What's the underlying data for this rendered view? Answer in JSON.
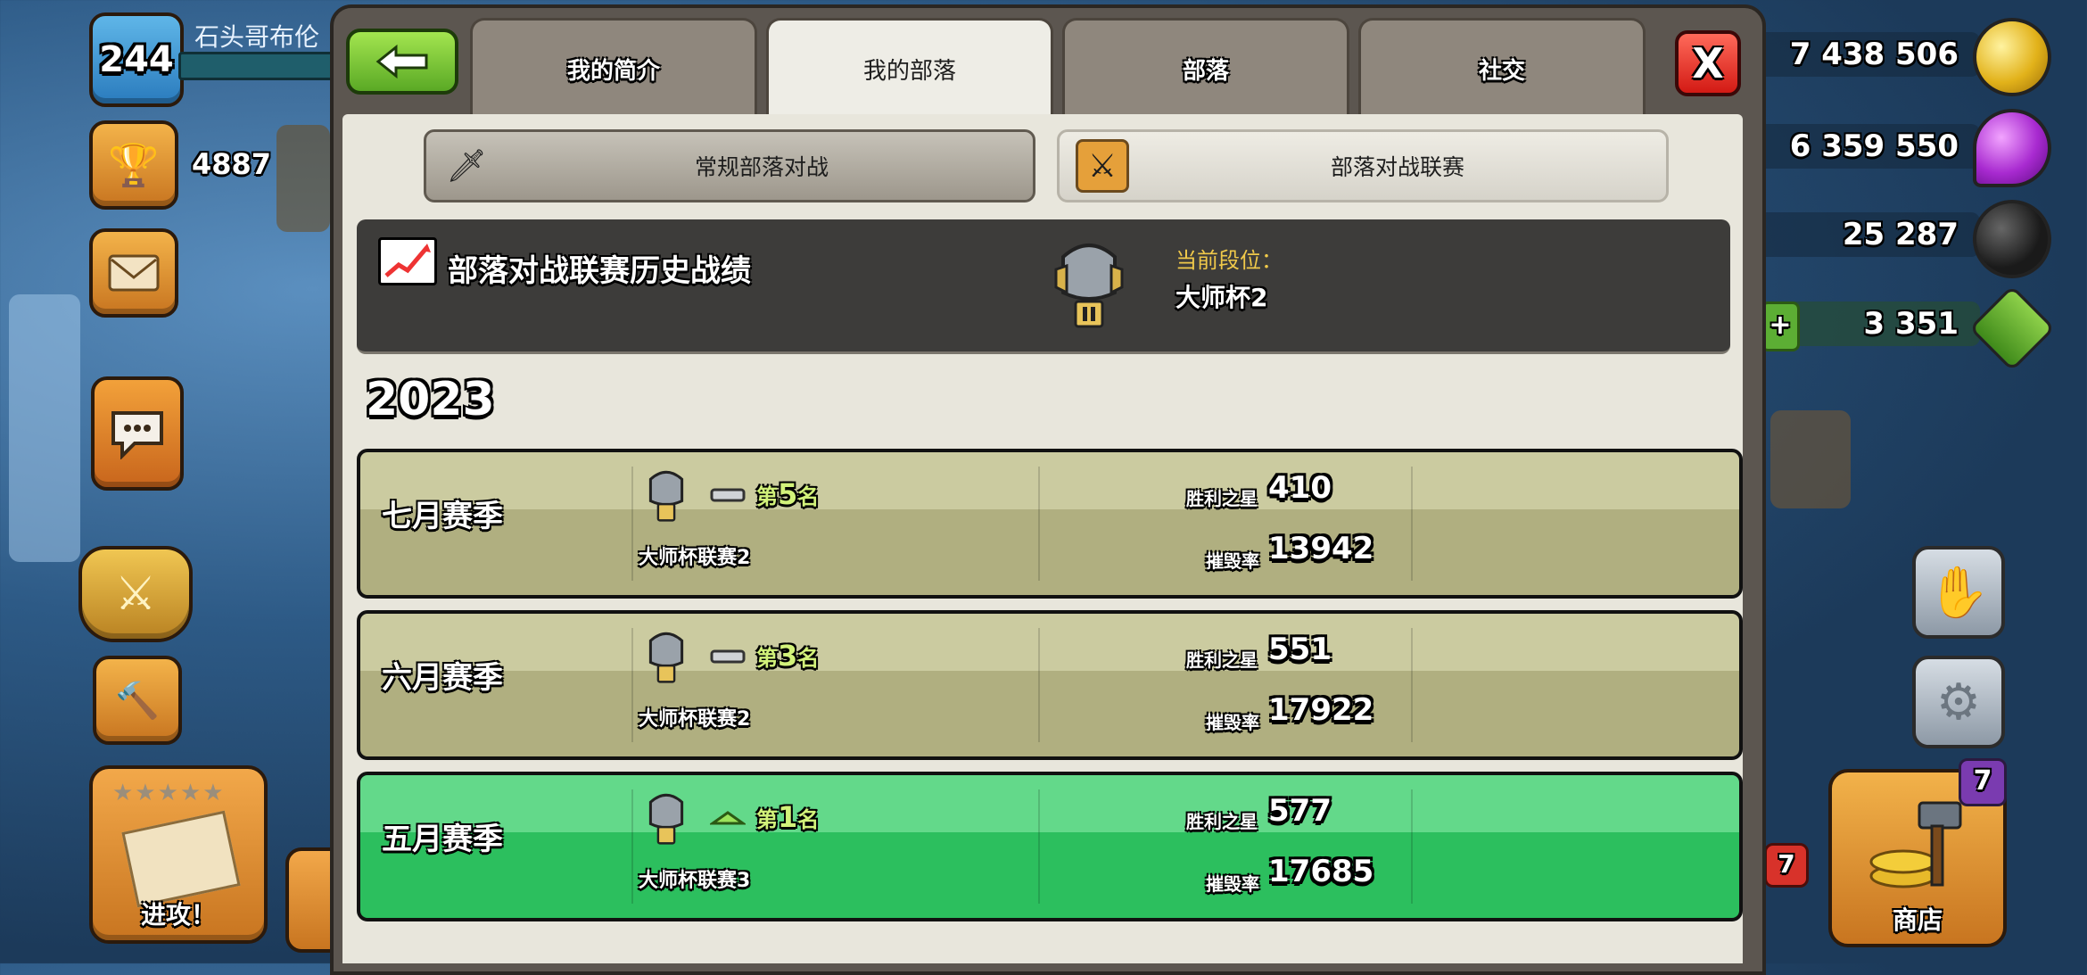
{
  "hud": {
    "level": "244",
    "player_name": "石头哥布伦",
    "trophies": "4887",
    "attack_label": "进攻！",
    "attack_stars": "★★★★★"
  },
  "resources": {
    "gold": "7 438 506",
    "elixir": "6 359 550",
    "dark_elixir": "25 287",
    "gems": "3 351"
  },
  "right_hud": {
    "shop_label": "商店",
    "shop_badge": "7",
    "notification_badge": "7"
  },
  "tabs": [
    {
      "label": "我的简介"
    },
    {
      "label": "我的部落"
    },
    {
      "label": "部落"
    },
    {
      "label": "社交"
    }
  ],
  "subtabs": {
    "regular_war": "常规部落对战",
    "war_league": "部落对战联赛"
  },
  "history": {
    "title": "部落对战联赛历史战绩",
    "current_rank_label": "当前段位：",
    "current_rank_value": "大师杯2"
  },
  "year": "2023",
  "seasons": [
    {
      "name": "七月赛季",
      "rank_prefix": "第",
      "rank": "5",
      "rank_suffix": "名",
      "league": "大师杯联赛2",
      "stars_label": "胜利之星",
      "stars": "410",
      "destruction_label": "摧毁率",
      "destruction": "13942",
      "trend": "same"
    },
    {
      "name": "六月赛季",
      "rank_prefix": "第",
      "rank": "3",
      "rank_suffix": "名",
      "league": "大师杯联赛2",
      "stars_label": "胜利之星",
      "stars": "551",
      "destruction_label": "摧毁率",
      "destruction": "17922",
      "trend": "same"
    },
    {
      "name": "五月赛季",
      "rank_prefix": "第",
      "rank": "1",
      "rank_suffix": "名",
      "league": "大师杯联赛3",
      "stars_label": "胜利之星",
      "stars": "577",
      "destruction_label": "摧毁率",
      "destruction": "17685",
      "trend": "up"
    }
  ],
  "colors": {
    "olive_row": "#b0af80",
    "green_row": "#2cbf5e",
    "rank_label": "#f0c94a",
    "rank_accent": "#d2f27a"
  }
}
